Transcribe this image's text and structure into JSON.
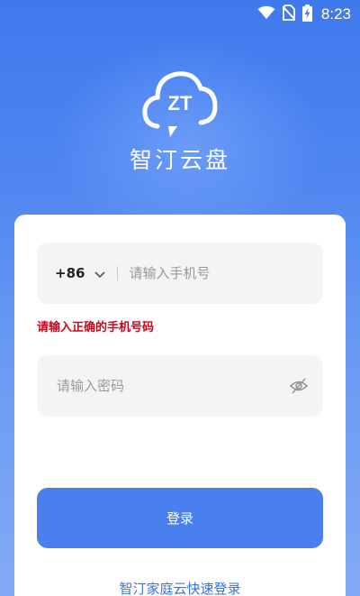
{
  "status_bar": {
    "time": "8:23",
    "icons": [
      "wifi-icon",
      "no-sim-icon",
      "battery-charging-icon"
    ]
  },
  "app": {
    "logo_text": "ZT",
    "name": "智汀云盘"
  },
  "login_form": {
    "country_code": "+86",
    "phone_placeholder": "请输入手机号",
    "phone_value": "",
    "phone_error": "请输入正确的手机号码",
    "password_placeholder": "请输入密码",
    "password_value": "",
    "login_label": "登录",
    "quick_login_label": "智汀家庭云快速登录"
  },
  "colors": {
    "primary": "#4a80ee",
    "error": "#d0021b",
    "link": "#3a6fdc",
    "field_bg": "#f3f4f6"
  }
}
